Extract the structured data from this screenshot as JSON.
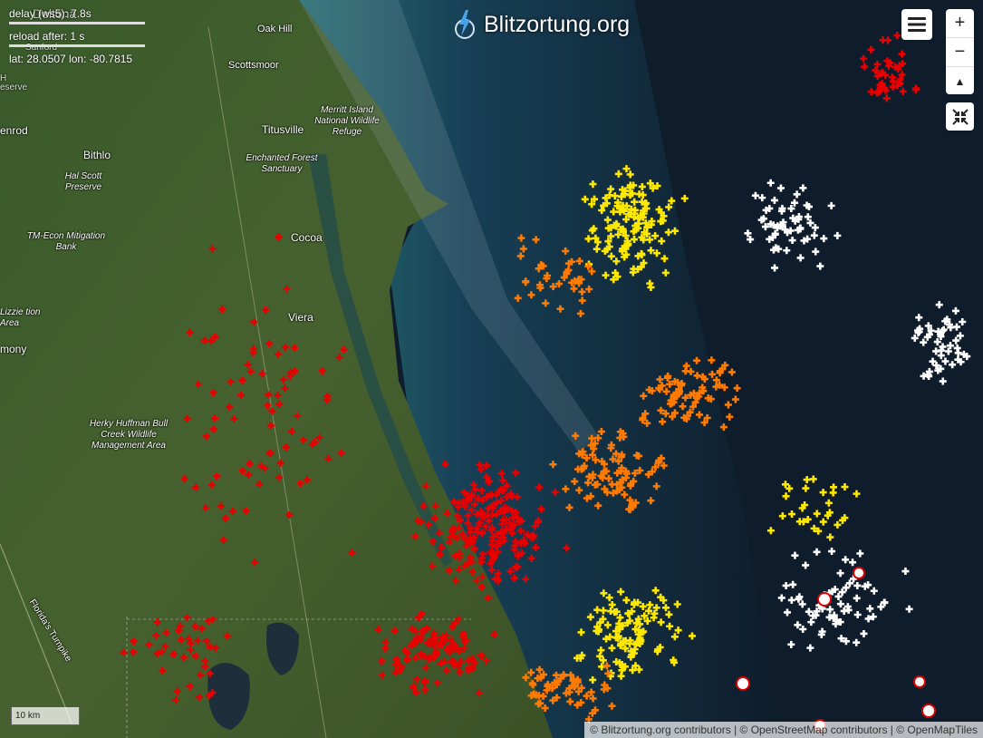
{
  "header": {
    "brand": "Blitzortung.org"
  },
  "status": {
    "delay_label": "delay (ws5): 7.8s",
    "reload_label": "reload after: 1 s",
    "coords_label": "lat: 28.0507 lon: -80.7815"
  },
  "controls": {
    "zoom_in": "+",
    "zoom_out": "−",
    "reset_north": "▲"
  },
  "scale": {
    "label": "10 km"
  },
  "attribution": "© Blitzortung.org contributors | © OpenStreetMap contributors | © OpenMapTiles",
  "places": {
    "deltona": "Deltona",
    "sanford": "Sanford",
    "oak_hill": "Oak Hill",
    "scottsmoor": "Scottsmoor",
    "titusville": "Titusville",
    "merritt_island": "Merritt Island National Wildlife Refuge",
    "enchanted_forest": "Enchanted Forest Sanctuary",
    "bithlo": "Bithlo",
    "enrod": "enrod",
    "hal_scott": "Hal Scott Preserve",
    "cocoa": "Cocoa",
    "tm_econ": "TM-Econ Mitigation Bank",
    "viera": "Viera",
    "lizzie": "Lizzie tion Area",
    "mony": "mony",
    "herky": "Herky Huffman Bull Creek Wildlife Management Area",
    "turnpike": "Florida's Turnpike",
    "reserve": "H eserve"
  },
  "colors": {
    "land": "#3f5a2a",
    "ocean": "#0e1c2b",
    "shore": "#2f7f86",
    "strike_red": "#e80000",
    "strike_orange": "#ff7a00",
    "strike_yellow": "#ffe800",
    "strike_white": "#ffffff"
  },
  "icons": {
    "brand": "lightning-bolt-icon",
    "menu": "menu-icon",
    "collapse": "collapse-icon"
  }
}
